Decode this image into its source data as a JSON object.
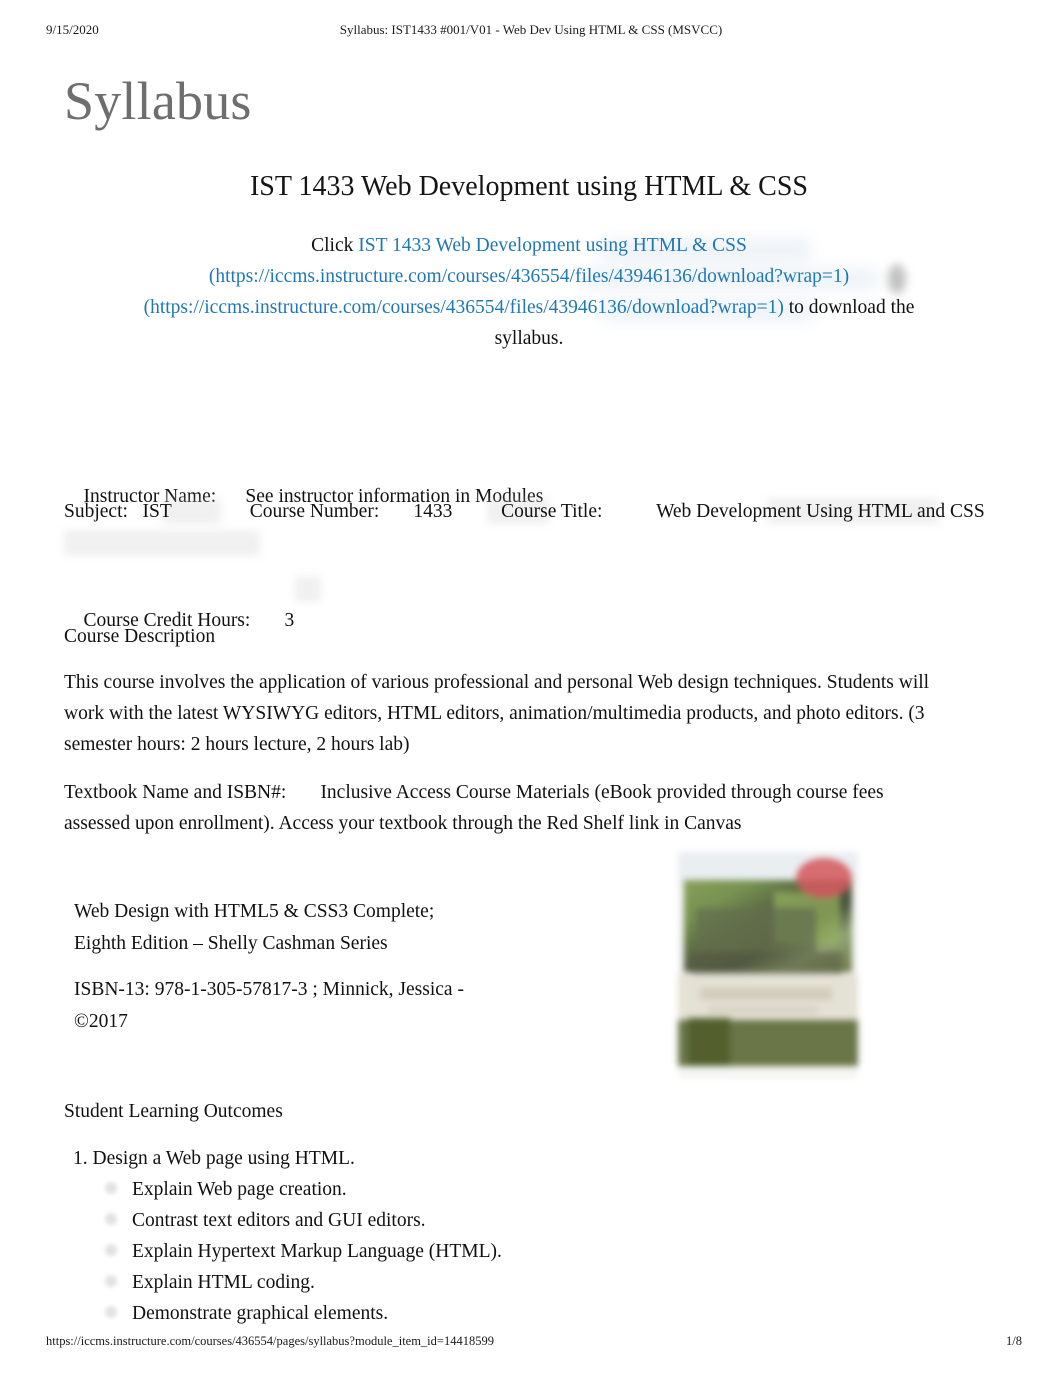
{
  "print_header": {
    "date": "9/15/2020",
    "title": "Syllabus: IST1433 #001/V01 - Web Dev Using HTML & CSS (MSVCC)"
  },
  "document": {
    "title": "Syllabus",
    "title_color": "#6e6e6e",
    "course_heading": "IST 1433 Web Development using HTML & CSS",
    "link_color": "#1f78b4"
  },
  "click_block": {
    "lead": "Click ",
    "link_text": "IST 1433 Web Development using HTML & CSS",
    "link_url_1": "(https://iccms.instructure.com/courses/436554/files/43946136/download?wrap=1)",
    "link_url_2": "(https://iccms.instructure.com/courses/436554/files/43946136/download?wrap=1)",
    "tail_1": " to download the",
    "tail_2": "syllabus."
  },
  "meta": {
    "instructor_label": "Instructor Name:",
    "instructor_value": "See instructor information in Modules",
    "subject_label": "Subject:",
    "subject_value": "IST",
    "course_number_label": "Course Number:",
    "course_number_value": "1433",
    "course_title_label": "Course Title:",
    "course_title_value": "Web Development",
    "course_title_value_line2": "Using HTML and CSS",
    "credit_hours_label": "Course Credit Hours:",
    "credit_hours_value": "3"
  },
  "course_description": {
    "heading": "Course Description",
    "body": "This course involves the application of various professional and personal Web design techniques. Students will work with the latest WYSIWYG editors, HTML editors, animation/multimedia products, and photo editors. (3 semester hours: 2 hours lecture, 2 hours lab)"
  },
  "textbook": {
    "label": "Textbook Name and ISBN#:",
    "body": "Inclusive Access Course Materials (eBook provided through course fees assessed upon enrollment). Access your textbook through the Red Shelf link in Canvas",
    "title_line_1": "Web Design with HTML5 & CSS3 Complete;",
    "title_line_2": "Eighth Edition – Shelly Cashman Series",
    "isbn_line_1": "ISBN-13: 978-1-305-57817-3    ; Minnick, Jessica -",
    "isbn_line_2": "©2017",
    "cover_alt": "book-cover-image"
  },
  "outcomes": {
    "heading": "Student Learning Outcomes",
    "items": [
      {
        "number": "1.",
        "text": "Design a Web page using HTML.",
        "sub": [
          "Explain Web page creation.",
          "Contrast text editors and GUI editors.",
          "Explain Hypertext Markup Language (HTML).",
          "Explain HTML coding.",
          "Demonstrate graphical elements."
        ]
      }
    ]
  },
  "print_footer": {
    "url": "https://iccms.instructure.com/courses/436554/pages/syllabus?module_item_id=14418599",
    "page": "1/8"
  }
}
